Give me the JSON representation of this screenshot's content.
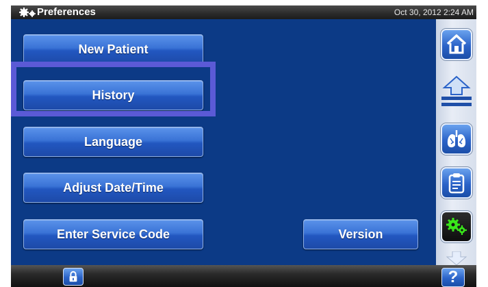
{
  "titlebar": {
    "icon": "gears-icon",
    "title": "Preferences",
    "timestamp": "Oct 30, 2012 2:24 AM"
  },
  "menu": {
    "new_patient": "New Patient",
    "history": "History",
    "language": "Language",
    "adjust_date_time": "Adjust Date/Time",
    "enter_service_code": "Enter Service Code",
    "version": "Version"
  },
  "sidebar": {
    "items": [
      {
        "icon": "home-icon"
      },
      {
        "icon": "scroll-up-arrow-icon"
      },
      {
        "icon": "lungs-icon"
      },
      {
        "icon": "clipboard-icon"
      },
      {
        "icon": "gears-icon",
        "active": true
      },
      {
        "icon": "scroll-down-arrow-icon"
      }
    ]
  },
  "bottombar": {
    "lock_icon": "lock-icon",
    "help_label": "?"
  },
  "colors": {
    "main_background": "#0c3a86",
    "highlight_border": "#5b5ad6",
    "button_blue": "#3a73d6",
    "active_gear_green": "#39e61a"
  }
}
